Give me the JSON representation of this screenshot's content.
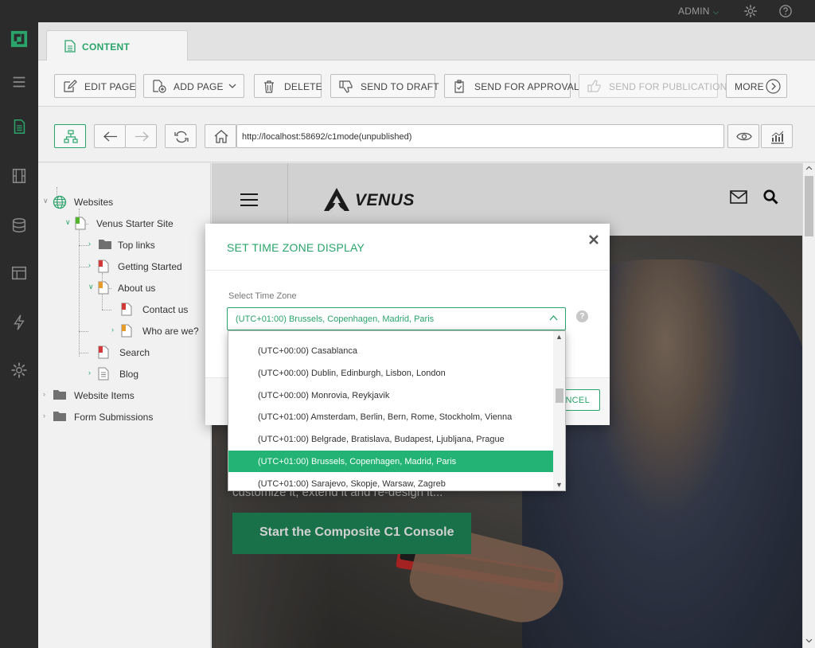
{
  "topbar": {
    "user": "ADMIN"
  },
  "tab": {
    "label": "CONTENT"
  },
  "toolbar": {
    "edit_page": "EDIT PAGE",
    "add_page": "ADD PAGE",
    "delete": "DELETE",
    "send_to_draft": "SEND TO DRAFT",
    "send_for_approval": "SEND FOR APPROVAL",
    "send_for_publication": "SEND FOR PUBLICATION",
    "more": "MORE"
  },
  "address": {
    "url": "http://localhost:58692/c1mode(unpublished)"
  },
  "tree": {
    "websites": "Websites",
    "site": "Venus Starter Site",
    "top_links": "Top links",
    "getting_started": "Getting Started",
    "about_us": "About us",
    "contact_us": "Contact us",
    "who_are_we": "Who are we?",
    "search": "Search",
    "blog": "Blog",
    "website_items": "Website Items",
    "form_submissions": "Form Submissions"
  },
  "preview": {
    "brand": "VENUS",
    "tagline": "customize it, extend it and re-design it...",
    "cta": "Start the Composite C1 Console"
  },
  "dialog": {
    "title": "SET TIME ZONE DISPLAY",
    "field_label": "Select Time Zone",
    "selected": "(UTC+01:00) Brussels, Copenhagen, Madrid, Paris",
    "help": "?",
    "cancel": "CANCEL"
  },
  "dropdown": {
    "options": [
      "(UTC+00:00) Casablanca",
      "(UTC+00:00) Dublin, Edinburgh, Lisbon, London",
      "(UTC+00:00) Monrovia, Reykjavik",
      "(UTC+01:00) Amsterdam, Berlin, Bern, Rome, Stockholm, Vienna",
      "(UTC+01:00) Belgrade, Bratislava, Budapest, Ljubljana, Prague",
      "(UTC+01:00) Brussels, Copenhagen, Madrid, Paris",
      "(UTC+01:00) Sarajevo, Skopje, Warsaw, Zagreb"
    ],
    "selected_index": 5
  },
  "colors": {
    "accent": "#2aa46b",
    "selected_option": "#23b374",
    "cta": "#1f8a5a",
    "dark_rail": "#2b2b2b"
  }
}
